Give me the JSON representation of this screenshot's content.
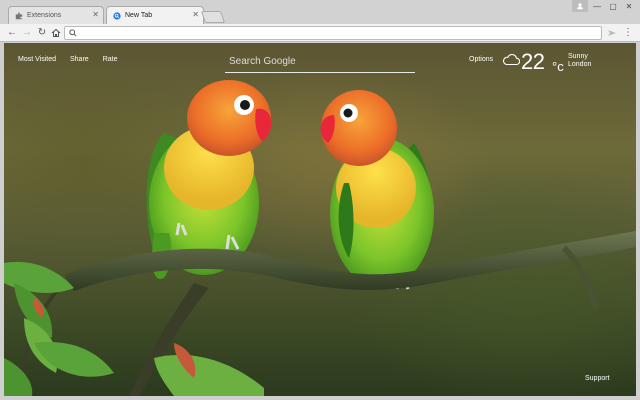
{
  "browser": {
    "tabs": [
      {
        "label": "Extensions",
        "icon": "puzzle-icon",
        "active": false
      },
      {
        "label": "New Tab",
        "icon": "search-logo-icon",
        "active": true
      }
    ],
    "omnibox": {
      "value": "",
      "placeholder": ""
    }
  },
  "page": {
    "nav": {
      "most_visited": "Most Visited",
      "share": "Share",
      "rate": "Rate"
    },
    "search": {
      "placeholder": "Search Google"
    },
    "options_label": "Options",
    "weather": {
      "temperature": "22",
      "unit": "°c",
      "condition": "Sunny",
      "city": "London",
      "icon": "cloud-icon"
    },
    "support_label": "Support"
  },
  "colors": {
    "bird_body": "#7cc52a",
    "bird_chest": "#f0d230",
    "bird_head": "#f07a2a",
    "beak": "#e8283a"
  }
}
